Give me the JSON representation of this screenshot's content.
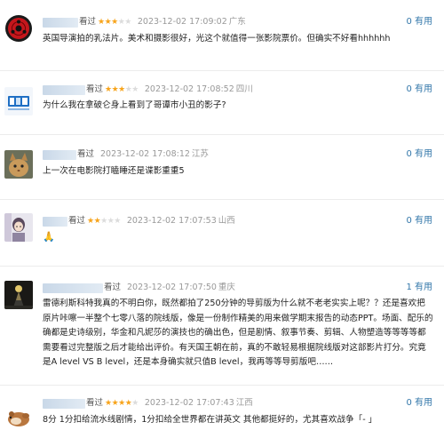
{
  "comments": [
    {
      "rating_label": "看过",
      "stars": 3,
      "time": "2023-12-02 17:09:02",
      "location": "广东",
      "useful": "0 有用",
      "text": "英国导演拍的乳法片。美术和摄影很好，光这个就值得一张影院票价。但确实不好看hhhhhh",
      "avatar_icon": "red-sharingan-avatar-icon"
    },
    {
      "rating_label": "看过",
      "stars": 3,
      "time": "2023-12-02 17:08:52",
      "location": "四川",
      "useful": "0 有用",
      "text": "为什么我在拿破仑身上看到了哥谭市小丑的影子?",
      "avatar_icon": "blue-logo-avatar-icon"
    },
    {
      "rating_label": "看过",
      "stars": 0,
      "time": "2023-12-02 17:08:12",
      "location": "江苏",
      "useful": "0 有用",
      "text": "上一次在电影院打瞌睡还是谍影重重5",
      "avatar_icon": "cat-avatar-icon"
    },
    {
      "rating_label": "看过",
      "stars": 2,
      "time": "2023-12-02 17:07:53",
      "location": "山西",
      "useful": "0 有用",
      "text": "🙏",
      "avatar_icon": "character-avatar-icon"
    },
    {
      "rating_label": "看过",
      "stars": 0,
      "time": "2023-12-02 17:07:50",
      "location": "重庆",
      "useful": "1 有用",
      "text": "雷德利斯科特我真的不明白你，既然都拍了250分钟的导剪版为什么就不老老实实上呢？？还是喜欢把原片咔嚓一半整个七零八落的院线版，像是一份制作精美的用来做学期末报告的动态PPT。场面、配乐的确都是史诗级别，华金和凡妮莎的演技也的确出色，但是剧情、叙事节奏、剪辑、人物塑造等等等等都需要看过完整版之后才能给出评价。有天国王朝在前，真的不敢轻易根据院线版对这部影片打分。究竟是A level VS B level，还是本身确实就只值B level，我再等等导剪版吧……",
      "avatar_icon": "dark-figure-avatar-icon"
    },
    {
      "rating_label": "看过",
      "stars": 4,
      "time": "2023-12-02 17:07:43",
      "location": "江西",
      "useful": "0 有用",
      "text": "8分 1分扣给流水线剧情，1分扣给全世界都在讲英文 其他都挺好的，尤其喜欢战争「- 」",
      "avatar_icon": "hamster-avatar-icon"
    }
  ]
}
